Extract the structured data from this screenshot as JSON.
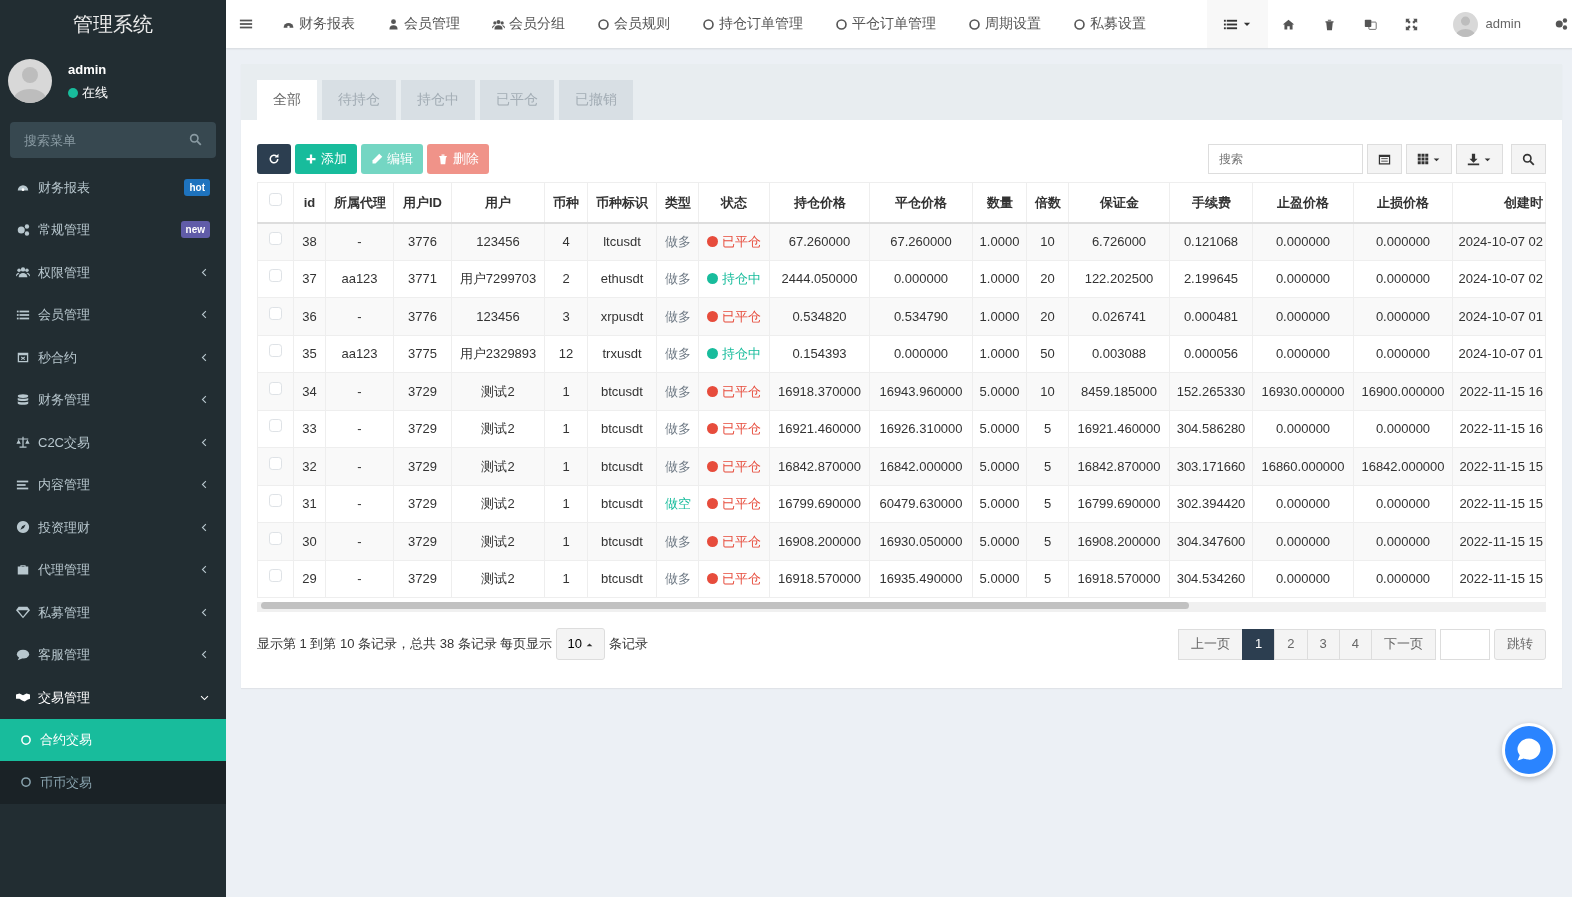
{
  "sidebar": {
    "title": "管理系统",
    "user": {
      "name": "admin",
      "status": "在线"
    },
    "search": {
      "placeholder": "搜索菜单"
    },
    "items": [
      {
        "label": "财务报表",
        "badge": "hot",
        "color": "#1e73be",
        "expanded": false
      },
      {
        "label": "常规管理",
        "badge": "new",
        "color": "#605ca8",
        "expanded": false
      },
      {
        "label": "权限管理",
        "expanded": false
      },
      {
        "label": "会员管理",
        "expanded": false
      },
      {
        "label": "秒合约",
        "expanded": false
      },
      {
        "label": "财务管理",
        "expanded": false
      },
      {
        "label": "C2C交易",
        "expanded": false
      },
      {
        "label": "内容管理",
        "expanded": false
      },
      {
        "label": "投资理财",
        "expanded": false
      },
      {
        "label": "代理管理",
        "expanded": false
      },
      {
        "label": "私募管理",
        "expanded": false
      },
      {
        "label": "客服管理",
        "expanded": false
      },
      {
        "label": "交易管理",
        "expanded": true,
        "children": [
          {
            "label": "合约交易",
            "selected": true
          },
          {
            "label": "币币交易",
            "selected": false
          }
        ]
      }
    ]
  },
  "topnav": {
    "items": [
      "财务报表",
      "会员管理",
      "会员分组",
      "会员规则",
      "持仓订单管理",
      "平仓订单管理",
      "周期设置",
      "私募设置"
    ],
    "user": "admin"
  },
  "tabs": [
    {
      "label": "全部",
      "selected": true
    },
    {
      "label": "待持仓",
      "selected": false
    },
    {
      "label": "持仓中",
      "selected": false
    },
    {
      "label": "已平仓",
      "selected": false
    },
    {
      "label": "已撤销",
      "selected": false
    }
  ],
  "toolbar": {
    "buttons": [
      {
        "kind": "refresh",
        "disabled": false
      },
      {
        "kind": "add",
        "label": "添加",
        "disabled": false
      },
      {
        "kind": "edit",
        "label": "编辑",
        "disabled": true
      },
      {
        "kind": "delete",
        "label": "删除",
        "disabled": true
      }
    ],
    "search": {
      "placeholder": "搜索"
    }
  },
  "table": {
    "select_all_checked": false,
    "columns": [
      "id",
      "所属代理",
      "用户ID",
      "用户",
      "币种",
      "币种标识",
      "类型",
      "状态",
      "持仓价格",
      "平仓价格",
      "数量",
      "倍数",
      "保证金",
      "手续费",
      "止盈价格",
      "止损价格",
      "创建时"
    ],
    "rows": [
      {
        "checked": false,
        "cells": [
          "38",
          "-",
          "3776",
          "123456",
          "4",
          "ltcusdt"
        ],
        "type": {
          "label": "做多",
          "kind": "long"
        },
        "status": {
          "label": "已平仓",
          "color": "#e74c3c"
        },
        "values": [
          "67.260000",
          "67.260000",
          "1.0000",
          "10",
          "6.726000",
          "0.121068",
          "0.000000",
          "0.000000",
          "2024-10-07 02"
        ]
      },
      {
        "checked": false,
        "cells": [
          "37",
          "aa123",
          "3771",
          "用户7299703",
          "2",
          "ethusdt"
        ],
        "type": {
          "label": "做多",
          "kind": "long"
        },
        "status": {
          "label": "持仓中",
          "color": "#18bc9c"
        },
        "values": [
          "2444.050000",
          "0.000000",
          "1.0000",
          "20",
          "122.202500",
          "2.199645",
          "0.000000",
          "0.000000",
          "2024-10-07 02"
        ]
      },
      {
        "checked": false,
        "cells": [
          "36",
          "-",
          "3776",
          "123456",
          "3",
          "xrpusdt"
        ],
        "type": {
          "label": "做多",
          "kind": "long"
        },
        "status": {
          "label": "已平仓",
          "color": "#e74c3c"
        },
        "values": [
          "0.534820",
          "0.534790",
          "1.0000",
          "20",
          "0.026741",
          "0.000481",
          "0.000000",
          "0.000000",
          "2024-10-07 01"
        ]
      },
      {
        "checked": false,
        "cells": [
          "35",
          "aa123",
          "3775",
          "用户2329893",
          "12",
          "trxusdt"
        ],
        "type": {
          "label": "做多",
          "kind": "long"
        },
        "status": {
          "label": "持仓中",
          "color": "#18bc9c"
        },
        "values": [
          "0.154393",
          "0.000000",
          "1.0000",
          "50",
          "0.003088",
          "0.000056",
          "0.000000",
          "0.000000",
          "2024-10-07 01"
        ]
      },
      {
        "checked": false,
        "cells": [
          "34",
          "-",
          "3729",
          "测试2",
          "1",
          "btcusdt"
        ],
        "type": {
          "label": "做多",
          "kind": "long"
        },
        "status": {
          "label": "已平仓",
          "color": "#e74c3c"
        },
        "values": [
          "16918.370000",
          "16943.960000",
          "5.0000",
          "10",
          "8459.185000",
          "152.265330",
          "16930.000000",
          "16900.000000",
          "2022-11-15 16"
        ]
      },
      {
        "checked": false,
        "cells": [
          "33",
          "-",
          "3729",
          "测试2",
          "1",
          "btcusdt"
        ],
        "type": {
          "label": "做多",
          "kind": "long"
        },
        "status": {
          "label": "已平仓",
          "color": "#e74c3c"
        },
        "values": [
          "16921.460000",
          "16926.310000",
          "5.0000",
          "5",
          "16921.460000",
          "304.586280",
          "0.000000",
          "0.000000",
          "2022-11-15 16"
        ]
      },
      {
        "checked": false,
        "cells": [
          "32",
          "-",
          "3729",
          "测试2",
          "1",
          "btcusdt"
        ],
        "type": {
          "label": "做多",
          "kind": "long"
        },
        "status": {
          "label": "已平仓",
          "color": "#e74c3c"
        },
        "values": [
          "16842.870000",
          "16842.000000",
          "5.0000",
          "5",
          "16842.870000",
          "303.171660",
          "16860.000000",
          "16842.000000",
          "2022-11-15 15"
        ]
      },
      {
        "checked": false,
        "cells": [
          "31",
          "-",
          "3729",
          "测试2",
          "1",
          "btcusdt"
        ],
        "type": {
          "label": "做空",
          "kind": "short"
        },
        "status": {
          "label": "已平仓",
          "color": "#e74c3c"
        },
        "values": [
          "16799.690000",
          "60479.630000",
          "5.0000",
          "5",
          "16799.690000",
          "302.394420",
          "0.000000",
          "0.000000",
          "2022-11-15 15"
        ]
      },
      {
        "checked": false,
        "cells": [
          "30",
          "-",
          "3729",
          "测试2",
          "1",
          "btcusdt"
        ],
        "type": {
          "label": "做多",
          "kind": "long"
        },
        "status": {
          "label": "已平仓",
          "color": "#e74c3c"
        },
        "values": [
          "16908.200000",
          "16930.050000",
          "5.0000",
          "5",
          "16908.200000",
          "304.347600",
          "0.000000",
          "0.000000",
          "2022-11-15 15"
        ]
      },
      {
        "checked": false,
        "cells": [
          "29",
          "-",
          "3729",
          "测试2",
          "1",
          "btcusdt"
        ],
        "type": {
          "label": "做多",
          "kind": "long"
        },
        "status": {
          "label": "已平仓",
          "color": "#e74c3c"
        },
        "values": [
          "16918.570000",
          "16935.490000",
          "5.0000",
          "5",
          "16918.570000",
          "304.534260",
          "0.000000",
          "0.000000",
          "2022-11-15 15"
        ]
      }
    ]
  },
  "footer": {
    "summary": "显示第 1 到第 10 条记录，总共 38 条记录 每页显示",
    "page_size": "10",
    "suffix": "条记录",
    "pages": [
      {
        "label": "上一页",
        "selected": false
      },
      {
        "label": "1",
        "selected": true
      },
      {
        "label": "2",
        "selected": false
      },
      {
        "label": "3",
        "selected": false
      },
      {
        "label": "4",
        "selected": false
      },
      {
        "label": "下一页",
        "selected": false
      }
    ],
    "jump": "跳转"
  }
}
